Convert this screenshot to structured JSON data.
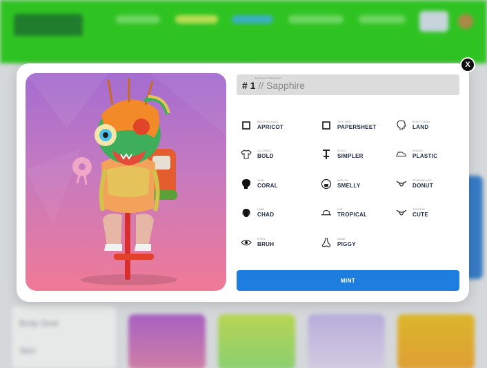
{
  "modal": {
    "close_label": "X",
    "id_sublabel": "MUTANT TRIGGER",
    "id_hash": "# 1",
    "id_name": "// Sapphire",
    "mint_label": "MINT"
  },
  "traits": [
    {
      "icon": "square-icon",
      "category": "BACKGROUND",
      "value": "APRICOT"
    },
    {
      "icon": "square-icon",
      "category": "TEXTURE",
      "value": "PAPERSHEET"
    },
    {
      "icon": "head-profile-icon",
      "category": "BODY GEAR",
      "value": "LAND"
    },
    {
      "icon": "shirt-icon",
      "category": "CLOTHES",
      "value": "BOLD"
    },
    {
      "icon": "pogo-icon",
      "category": "POGO",
      "value": "SIMPLER"
    },
    {
      "icon": "shoe-icon",
      "category": "SHOES",
      "value": "PLASTIC"
    },
    {
      "icon": "skin-icon",
      "category": "SKIN",
      "value": "CORAL"
    },
    {
      "icon": "mouth-face-icon",
      "category": "MOUTH",
      "value": "SMELLY"
    },
    {
      "icon": "tongue-icon",
      "category": "TONGUE ACC.",
      "value": "DONUT"
    },
    {
      "icon": "hair-icon",
      "category": "HAIR",
      "value": "CHAD"
    },
    {
      "icon": "hat-icon",
      "category": "HAT",
      "value": "TROPICAL"
    },
    {
      "icon": "tongue-icon",
      "category": "TONGUE",
      "value": "CUTE"
    },
    {
      "icon": "eye-icon",
      "category": "EYES",
      "value": "BRUH"
    },
    {
      "icon": "nose-icon",
      "category": "NOSE",
      "value": "PIGGY"
    }
  ],
  "background_page": {
    "sidebar_items": [
      "Body Gear",
      "Skin"
    ]
  },
  "colors": {
    "topbar": "#1fd20e",
    "mint_button": "#1e7ee0",
    "art_gradient_top": "#a46dd0",
    "art_gradient_bottom": "#f07a96"
  }
}
